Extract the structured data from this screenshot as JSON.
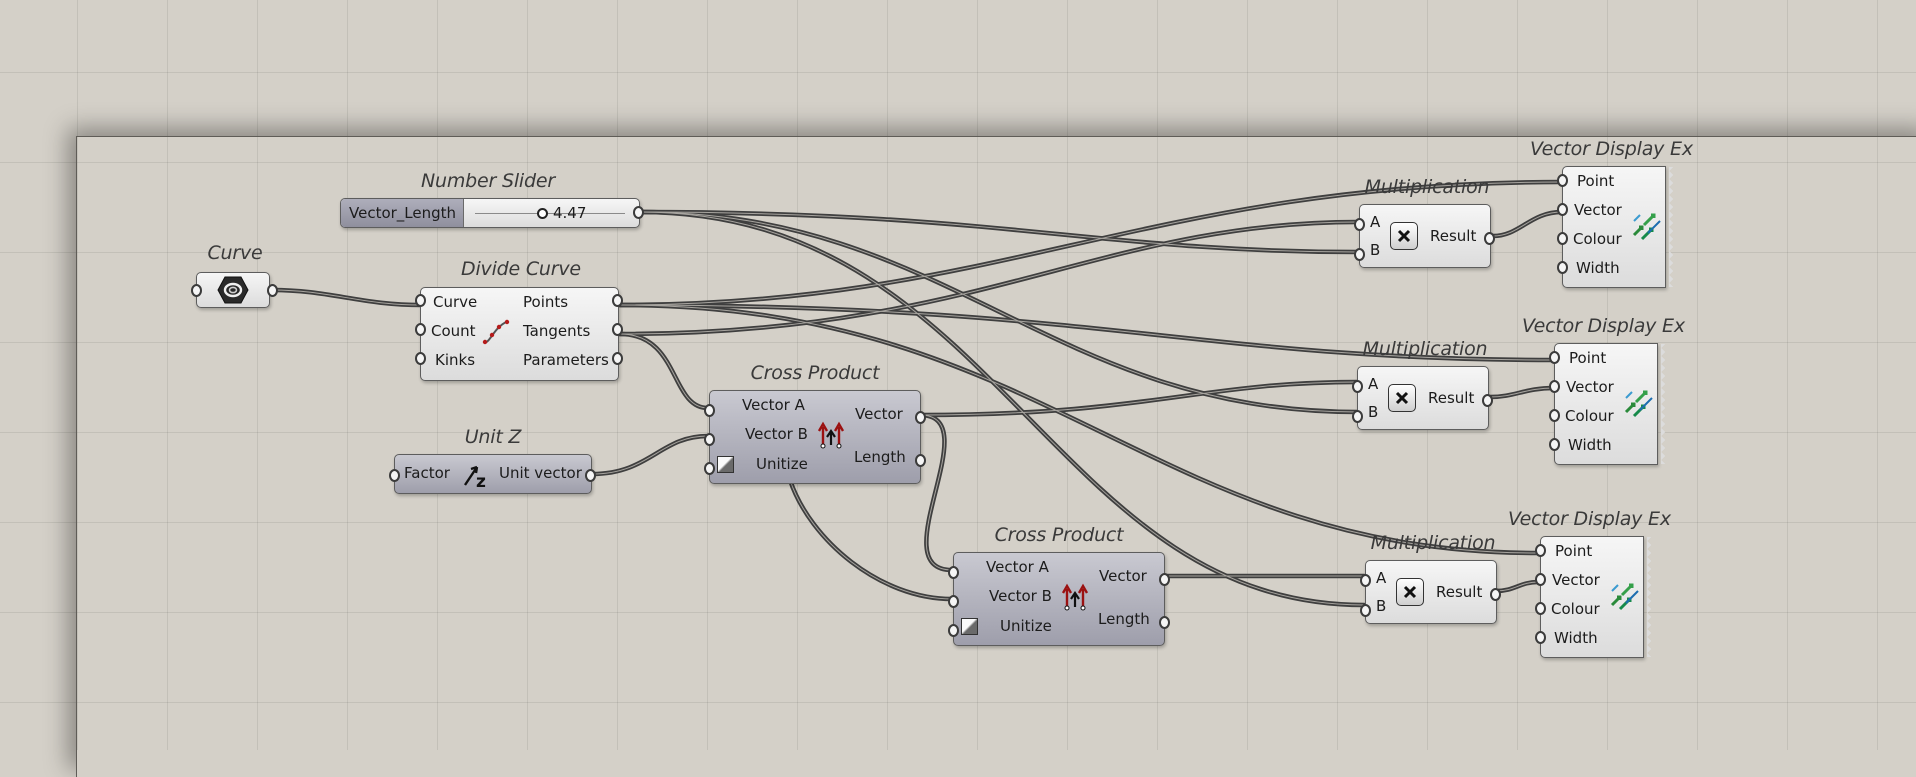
{
  "canvas": {
    "background": "#d4d0c8",
    "wire_color": "#3d3d3d"
  },
  "components": {
    "curve": {
      "title": "Curve",
      "icon": "curve-param-icon"
    },
    "number_slider": {
      "title": "Number Slider",
      "name": "Vector_Length",
      "value": "4.47"
    },
    "divide_curve": {
      "title": "Divide Curve",
      "inputs": [
        "Curve",
        "Count",
        "Kinks"
      ],
      "outputs": [
        "Points",
        "Tangents",
        "Parameters"
      ],
      "icon": "divide-curve-icon"
    },
    "unit_z": {
      "title": "Unit Z",
      "input": "Factor",
      "output": "Unit vector",
      "icon": "unit-z-icon"
    },
    "cross_product_1": {
      "title": "Cross Product",
      "inputs": [
        "Vector A",
        "Vector B",
        "Unitize"
      ],
      "outputs": [
        "Vector",
        "Length"
      ],
      "icon": "cross-product-icon"
    },
    "cross_product_2": {
      "title": "Cross Product",
      "inputs": [
        "Vector A",
        "Vector B",
        "Unitize"
      ],
      "outputs": [
        "Vector",
        "Length"
      ],
      "icon": "cross-product-icon"
    },
    "multiplication_1": {
      "title": "Multiplication",
      "inputs": [
        "A",
        "B"
      ],
      "output": "Result",
      "icon": "multiply-icon"
    },
    "multiplication_2": {
      "title": "Multiplication",
      "inputs": [
        "A",
        "B"
      ],
      "output": "Result",
      "icon": "multiply-icon"
    },
    "multiplication_3": {
      "title": "Multiplication",
      "inputs": [
        "A",
        "B"
      ],
      "output": "Result",
      "icon": "multiply-icon"
    },
    "vector_display_1": {
      "title": "Vector Display Ex",
      "inputs": [
        "Point",
        "Vector",
        "Colour",
        "Width"
      ],
      "icon": "vector-display-icon"
    },
    "vector_display_2": {
      "title": "Vector Display Ex",
      "inputs": [
        "Point",
        "Vector",
        "Colour",
        "Width"
      ],
      "icon": "vector-display-icon"
    },
    "vector_display_3": {
      "title": "Vector Display Ex",
      "inputs": [
        "Point",
        "Vector",
        "Colour",
        "Width"
      ],
      "icon": "vector-display-icon"
    }
  }
}
